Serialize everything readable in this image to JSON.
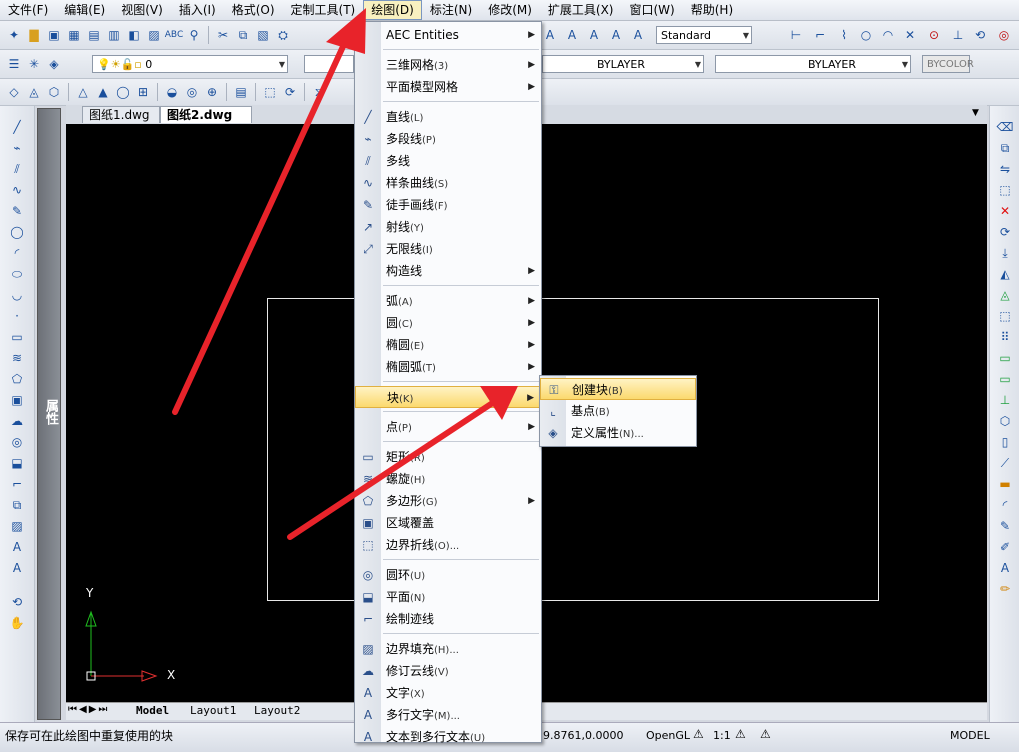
{
  "menubar": {
    "items": [
      "文件(F)",
      "编辑(E)",
      "视图(V)",
      "插入(I)",
      "格式(O)",
      "定制工具(T)",
      "绘图(D)",
      "标注(N)",
      "修改(M)",
      "扩展工具(X)",
      "窗口(W)",
      "帮助(H)"
    ],
    "active_index": 6
  },
  "toolbar": {
    "layer_value": "0",
    "text_style": "Standard",
    "linetype": "BYLAYER",
    "lineweight": "BYLAYER",
    "plotstyle": "BYCOLOR"
  },
  "panel": {
    "properties_label": "属性"
  },
  "tabs": [
    {
      "label": "图纸1.dwg"
    },
    {
      "label": "图纸2.dwg",
      "close": "✕"
    }
  ],
  "axes": {
    "y_label": "Y",
    "x_label": "X"
  },
  "layout_tabs": [
    "Model",
    "Layout1",
    "Layout2"
  ],
  "status": {
    "message": "保存可在此绘图中重复使用的块",
    "coords": "9.8761,0.0000",
    "opengl": "OpenGL",
    "scale": "1:1",
    "model": "MODEL"
  },
  "draw_menu": {
    "items": [
      {
        "label": "AEC Entities",
        "icon": "",
        "sub": true
      },
      {
        "sep": true
      },
      {
        "label": "三维网格",
        "sc": "(3)",
        "icon": "",
        "sub": true
      },
      {
        "label": "平面模型网格",
        "sc": "",
        "icon": "",
        "sub": true
      },
      {
        "sep": true
      },
      {
        "label": "直线",
        "sc": "(L)",
        "icon": "line-icon"
      },
      {
        "label": "多段线",
        "sc": "(P)",
        "icon": "polyline-icon"
      },
      {
        "label": "多线",
        "sc": "",
        "icon": "multiline-icon"
      },
      {
        "label": "样条曲线",
        "sc": "(S)",
        "icon": "spline-icon"
      },
      {
        "label": "徒手画线",
        "sc": "(F)",
        "icon": "freehand-icon"
      },
      {
        "label": "射线",
        "sc": "(Y)",
        "icon": "ray-icon"
      },
      {
        "label": "无限线",
        "sc": "(I)",
        "icon": "xline-icon"
      },
      {
        "label": "构造线",
        "sc": "",
        "icon": "",
        "sub": true
      },
      {
        "sep": true
      },
      {
        "label": "弧",
        "sc": "(A)",
        "icon": "",
        "sub": true
      },
      {
        "label": "圆",
        "sc": "(C)",
        "icon": "",
        "sub": true
      },
      {
        "label": "椭圆",
        "sc": "(E)",
        "icon": "",
        "sub": true
      },
      {
        "label": "椭圆弧",
        "sc": "(T)",
        "icon": "",
        "sub": true
      },
      {
        "sep": true
      },
      {
        "label": "块",
        "sc": "(K)",
        "icon": "",
        "sub": true,
        "highlight": true
      },
      {
        "sep": true
      },
      {
        "label": "点",
        "sc": "(P)",
        "icon": "",
        "sub": true
      },
      {
        "sep": true
      },
      {
        "label": "矩形",
        "sc": "(R)",
        "icon": "rectangle-icon"
      },
      {
        "label": "螺旋",
        "sc": "(H)",
        "icon": "helix-icon"
      },
      {
        "label": "多边形",
        "sc": "(G)",
        "icon": "polygon-icon",
        "sub": true
      },
      {
        "label": "区域覆盖",
        "sc": "",
        "icon": "wipeout-icon"
      },
      {
        "label": "边界折线",
        "sc": "(O)...",
        "icon": "boundary-icon"
      },
      {
        "sep": true
      },
      {
        "label": "圆环",
        "sc": "(U)",
        "icon": "donut-icon"
      },
      {
        "label": "平面",
        "sc": "(N)",
        "icon": "plane-icon"
      },
      {
        "label": "绘制迹线",
        "sc": "",
        "icon": "trace-icon"
      },
      {
        "sep": true
      },
      {
        "label": "边界填充",
        "sc": "(H)...",
        "icon": "hatch-icon"
      },
      {
        "label": "修订云线",
        "sc": "(V)",
        "icon": "revcloud-icon"
      },
      {
        "label": "文字",
        "sc": "(X)",
        "icon": "text-icon"
      },
      {
        "label": "多行文字",
        "sc": "(M)...",
        "icon": "mtext-icon"
      },
      {
        "label": "文本到多行文本",
        "sc": "(U)",
        "icon": "text-to-mtext-icon"
      }
    ]
  },
  "block_menu": {
    "items": [
      {
        "label": "创建块",
        "sc": "(B)",
        "icon": "create-block-icon",
        "highlight": true
      },
      {
        "label": "基点",
        "sc": "(B)",
        "icon": "base-point-icon"
      },
      {
        "label": "定义属性",
        "sc": "(N)...",
        "icon": "define-attribute-icon"
      }
    ]
  },
  "colors": {
    "arrow": "#e8232a",
    "canvas": "#000000",
    "highlight": "#fbd96e"
  }
}
